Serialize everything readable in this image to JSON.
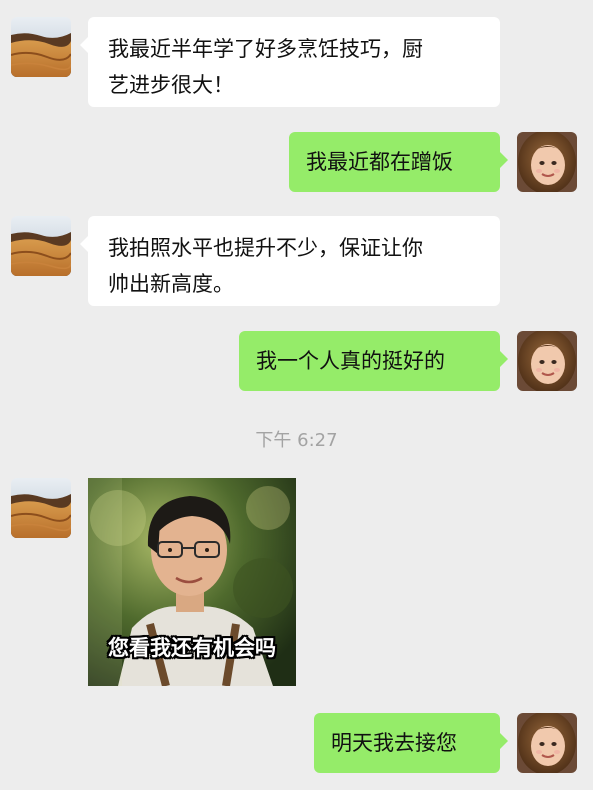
{
  "messages": [
    {
      "side": "in",
      "text": "我最近半年学了好多烹饪技巧，厨\n艺进步很大！"
    },
    {
      "side": "out",
      "text": "我最近都在蹭饭"
    },
    {
      "side": "in",
      "text": "我拍照水平也提升不少，保证让你\n帅出新高度。"
    },
    {
      "side": "out",
      "text": "我一个人真的挺好的"
    },
    {
      "side": "in",
      "type": "sticker",
      "caption": "您看我还有机会吗"
    },
    {
      "side": "out",
      "text": "明天我去接您"
    }
  ],
  "timestamp": "下午 6:27",
  "avatars": {
    "contact": "desert-landscape-avatar",
    "self": "girl-portrait-avatar"
  },
  "colors": {
    "background": "#ededed",
    "incoming_bubble": "#ffffff",
    "outgoing_bubble": "#95ec69",
    "timestamp": "#a3a3a3"
  }
}
